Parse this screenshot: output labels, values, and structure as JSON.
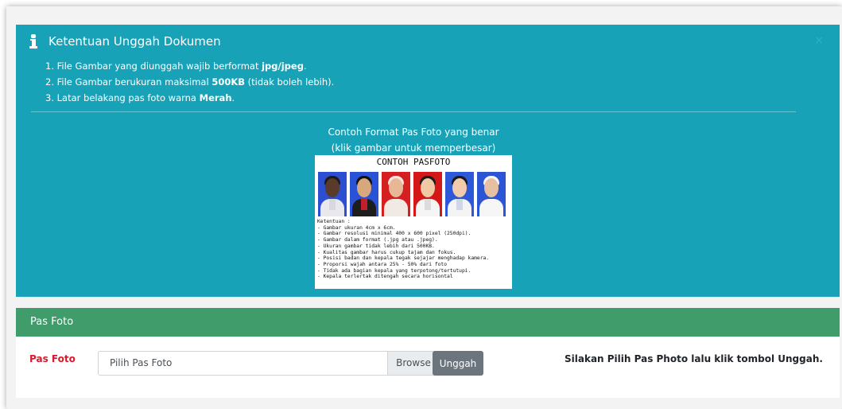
{
  "alert": {
    "title": "Ketentuan Unggah Dokumen",
    "rules": [
      {
        "pre": "1. File Gambar yang diunggah wajib berformat ",
        "bold": "jpg/jpeg",
        "post": "."
      },
      {
        "pre": "2. File Gambar berukuran maksimal ",
        "bold": "500KB",
        "post": " (tidak boleh lebih)."
      },
      {
        "pre": "3. Latar belakang pas foto warna ",
        "bold": "Merah",
        "post": "."
      }
    ],
    "example_caption_1": "Contoh Format Pas Foto yang benar",
    "example_caption_2": "(klik gambar untuk memperbesar)",
    "close_glyph": "×"
  },
  "example_image": {
    "title": "CONTOH PASFOTO",
    "notes": [
      "Ketentuan :",
      "- Gambar ukuran 4cm x 6cm.",
      "- Gambar resolusi minimal 400 x 600 pixel (250dpi).",
      "- Gambar dalam format (.jpg atau .jpeg).",
      "- Ukuran gambar tidak lebih dari 500KB.",
      "- Kualitas gambar harus cukup tajam dan fokus.",
      "- Posisi badan dan kepala tegak sejajar menghadap kamera.",
      "- Proporsi wajah antara 25% - 50% dari foto",
      "- Tidak ada bagian kepala yang terpotong/tertutupi.",
      "- Kepala terlertak ditengah secara horisontal"
    ],
    "photos": [
      {
        "bg": "#2b4fd0",
        "skin": "#5a3a2a",
        "hair": "#1a1a1a",
        "body": "#e8e8ee",
        "collar": "#d8d8e0"
      },
      {
        "bg": "#2a52d6",
        "skin": "#d7a87c",
        "hair": "#111111",
        "body": "#1d1d1d",
        "collar": "#c21f2a"
      },
      {
        "bg": "#d42020",
        "skin": "#e8b896",
        "hair": "#f1eae4",
        "body": "#f1eae4",
        "collar": "#f1eae4"
      },
      {
        "bg": "#d41818",
        "skin": "#f0c9a4",
        "hair": "#1c1c1c",
        "body": "#f5f5f5",
        "collar": "#dcdcdc"
      },
      {
        "bg": "#2d58d8",
        "skin": "#f1cbac",
        "hair": "#1a1a1a",
        "body": "#f4f4f4",
        "collar": "#cfd6e8"
      },
      {
        "bg": "#2b55d4",
        "skin": "#e6c0a0",
        "hair": "#f6f6f6",
        "body": "#f6f6f6",
        "collar": "#f6f6f6"
      }
    ]
  },
  "card": {
    "header": "Pas Foto",
    "field_label": "Pas Foto",
    "file_placeholder": "Pilih Pas Foto",
    "browse_label": "Browse",
    "upload_label": "Unggah",
    "hint": "Silakan Pilih Pas Photo lalu klik tombol Unggah."
  },
  "colors": {
    "alert_bg": "#17a2b8",
    "card_header_bg": "#419c6b",
    "label_red": "#d9182a",
    "button_gray": "#6c757d"
  }
}
